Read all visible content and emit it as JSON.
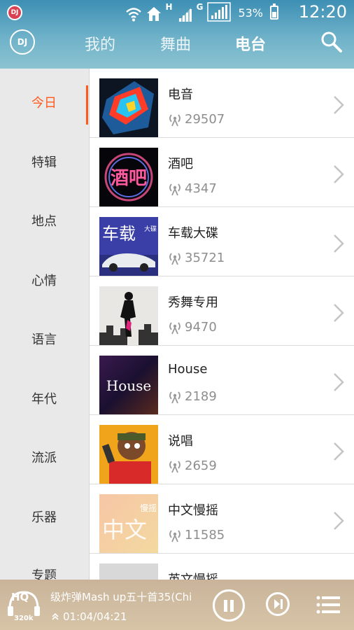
{
  "status_bar": {
    "app_icon": "DJ",
    "net_h": "H",
    "net_g": "G",
    "battery": "53%",
    "time": "12:20"
  },
  "header": {
    "logo": "DJ",
    "tabs": [
      {
        "label": "我的"
      },
      {
        "label": "舞曲"
      },
      {
        "label": "电台"
      }
    ]
  },
  "sidebar": {
    "items": [
      {
        "label": "今日"
      },
      {
        "label": "特辑"
      },
      {
        "label": "地点"
      },
      {
        "label": "心情"
      },
      {
        "label": "语言"
      },
      {
        "label": "年代"
      },
      {
        "label": "流派"
      },
      {
        "label": "乐器"
      },
      {
        "label": "专题"
      }
    ]
  },
  "stations": [
    {
      "title": "电音",
      "count": "29507"
    },
    {
      "title": "酒吧",
      "count": "4347"
    },
    {
      "title": "车载大碟",
      "count": "35721"
    },
    {
      "title": "秀舞专用",
      "count": "9470"
    },
    {
      "title": "House",
      "count": "2189"
    },
    {
      "title": "说唱",
      "count": "2659"
    },
    {
      "title": "中文慢摇",
      "count": "11585"
    },
    {
      "title": "英文慢摇",
      "count": ""
    }
  ],
  "thumbs": {
    "bar": "酒吧",
    "car_big": "车载",
    "car_small": "大碟",
    "house": "House",
    "zw_small": "慢摇",
    "zw_big": "中文"
  },
  "player": {
    "quality": "HQ",
    "bitrate": "320k",
    "song": "级炸弹Mash up五十首35(Chi",
    "time": "01:04/04:21"
  },
  "colors": {
    "accent": "#ff5a1e",
    "header": "#5ea8c3"
  }
}
